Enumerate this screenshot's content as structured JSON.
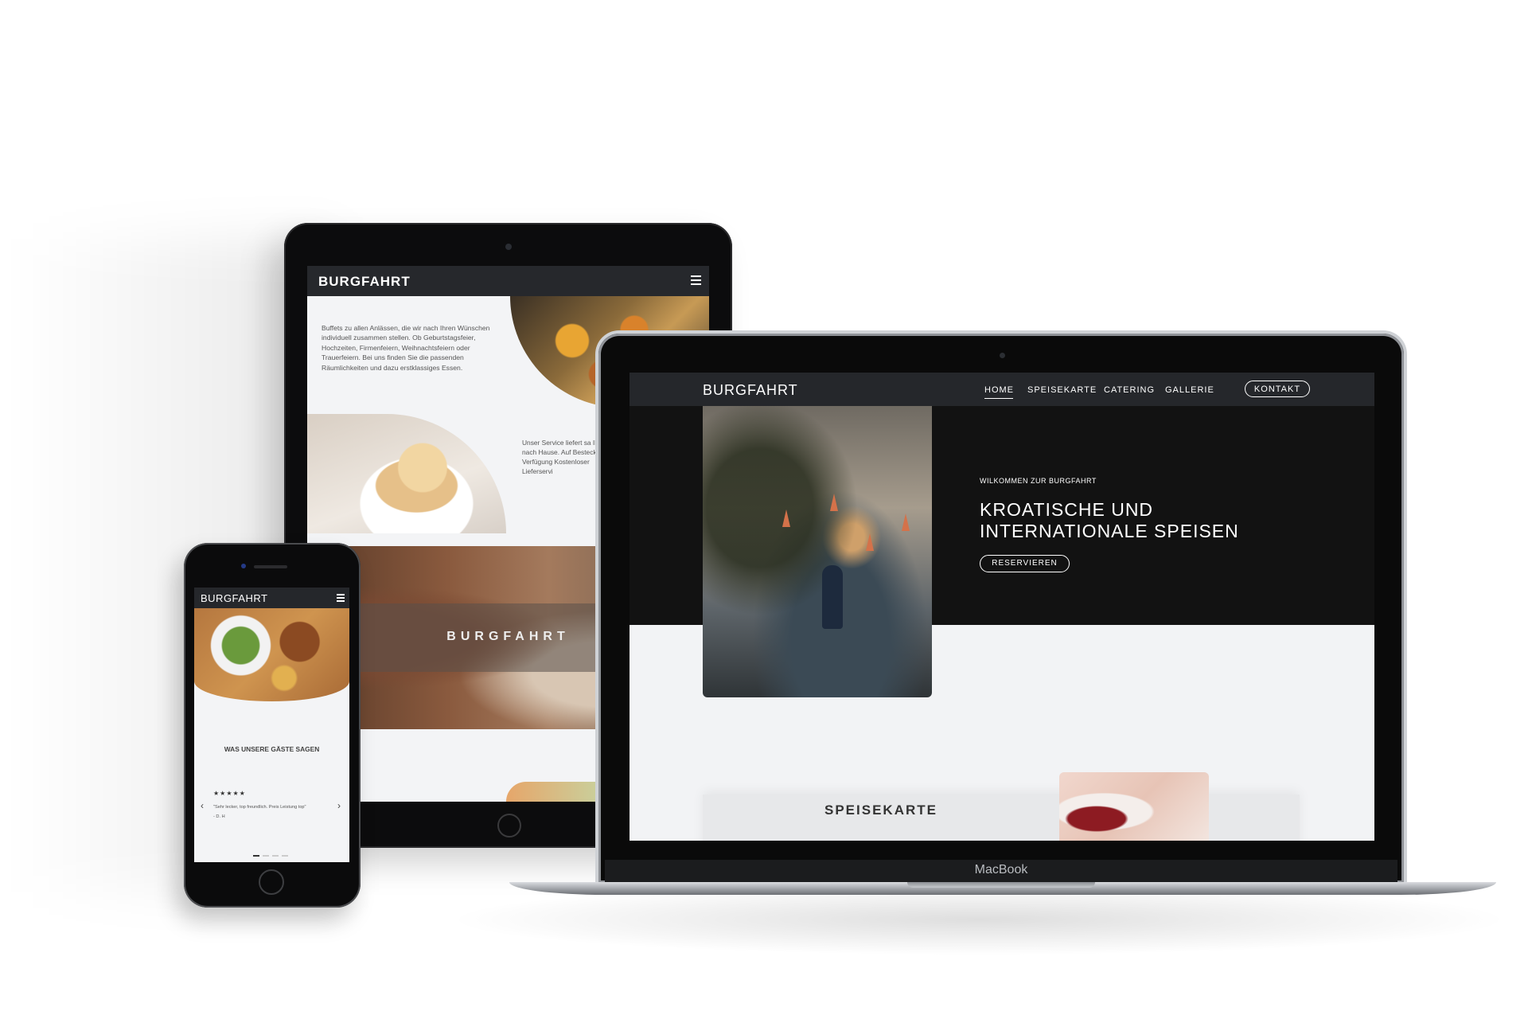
{
  "brand": "BURGFAHRT",
  "laptop": {
    "device_label": "MacBook",
    "nav": {
      "items": [
        {
          "label": "HOME"
        },
        {
          "label": "SPEISEKARTE"
        },
        {
          "label": "CATERING"
        },
        {
          "label": "GALLERIE"
        }
      ],
      "cta": "KONTAKT"
    },
    "hero": {
      "kicker": "WILKOMMEN ZUR BURGFAHRT",
      "headline": "KROATISCHE UND INTERNATIONALE SPEISEN",
      "button": "RESERVIEREN"
    },
    "section_title": "SPEISEKARTE"
  },
  "tablet": {
    "paragraph1": "Buffets zu allen Anlässen, die wir nach Ihren Wünschen individuell zusammen stellen. Ob Geburtstagsfeier, Hochzeiten, Firmenfeiern, Weihnachtsfeiern oder Trauerfeiern. Bei uns finden Sie die passenden Räumlichkeiten und dazu erstklassiges Essen.",
    "paragraph2": "Unser Service liefert sa Ihnen nach Hause. Auf Besteck zur Verfügung Kostenloser Lieferservi",
    "banner_title": "BURGFAHRT"
  },
  "phone": {
    "testimonials_heading": "WAS UNSERE GÄSTE SAGEN",
    "stars": "★★★★★",
    "quote": "\"Sehr lecker, top freundlich. Preis Leistung top\"",
    "author": "- D. H",
    "prev_arrow": "‹",
    "next_arrow": "›"
  }
}
